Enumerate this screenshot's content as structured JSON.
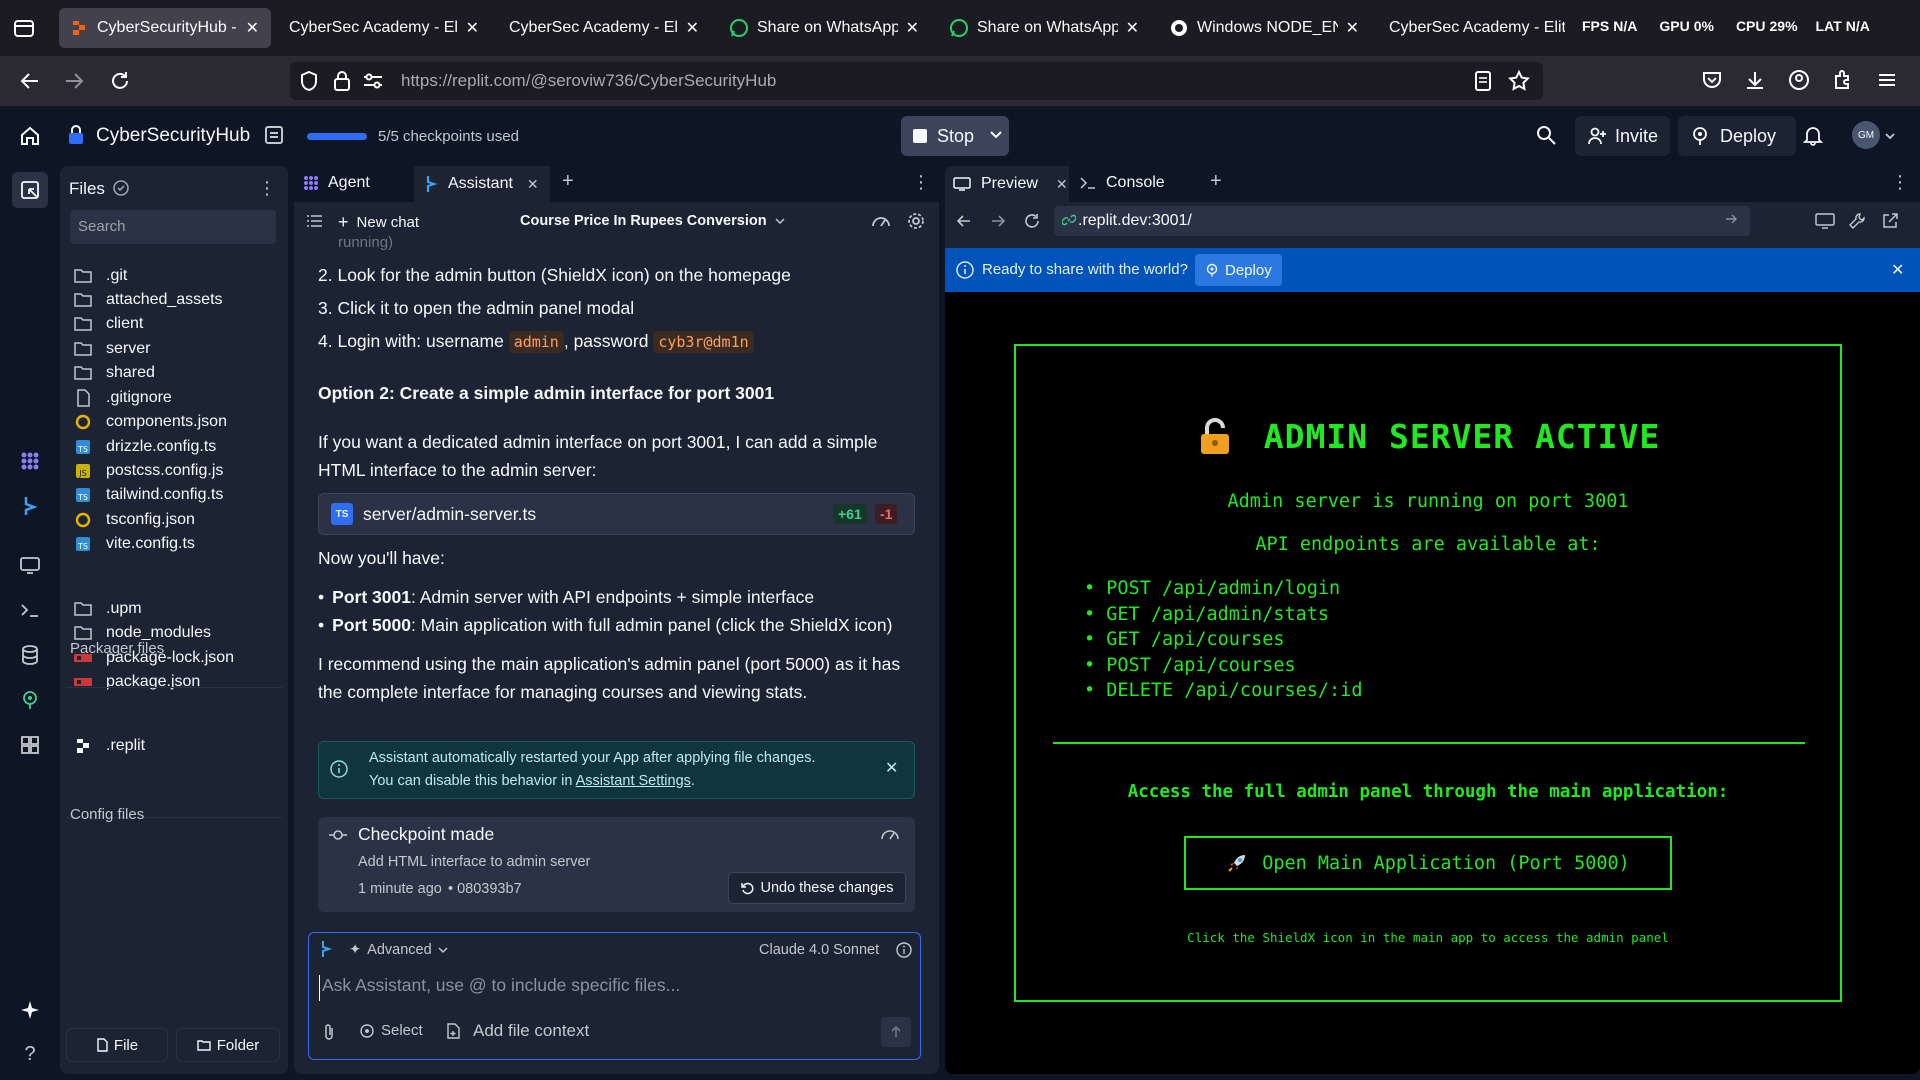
{
  "browser": {
    "tabs": [
      {
        "label": "CyberSecurityHub - Re",
        "active": true
      },
      {
        "label": "CyberSec Academy - Elite (",
        "active": false
      },
      {
        "label": "CyberSec Academy - Elite (",
        "active": false
      },
      {
        "label": "Share on WhatsApp",
        "active": false
      },
      {
        "label": "Share on WhatsApp",
        "active": false
      },
      {
        "label": "Windows NODE_ENV F",
        "active": false
      },
      {
        "label": "CyberSec Academy - Elite (",
        "active": false
      }
    ],
    "stats": {
      "fps_label": "FPS",
      "fps_value": "N/A",
      "gpu_label": "GPU",
      "gpu_value": "0%",
      "cpu_label": "CPU",
      "cpu_value": "29%",
      "lat_label": "LAT",
      "lat_value": "N/A"
    },
    "url_host": "https://replit.com",
    "url_path": "/@seroviw736/CyberSecurityHub"
  },
  "header": {
    "project_name": "CyberSecurityHub",
    "checkpoints": "5/5 checkpoints used",
    "checkpoint_fraction": 1.0,
    "stop_label": "Stop",
    "invite_label": "Invite",
    "deploy_label": "Deploy",
    "avatar_initials": "GM"
  },
  "files": {
    "title": "Files",
    "search_placeholder": "Search",
    "items": [
      ".git",
      "attached_assets",
      "client",
      "server",
      "shared",
      ".gitignore",
      "components.json",
      "drizzle.config.ts",
      "postcss.config.js",
      "tailwind.config.ts",
      "tsconfig.json",
      "vite.config.ts"
    ],
    "packager_title": "Packager files",
    "packager_items": [
      ".upm",
      "node_modules",
      "package-lock.json",
      "package.json"
    ],
    "config_title": "Config files",
    "config_items": [
      ".replit"
    ],
    "file_button": "File",
    "folder_button": "Folder"
  },
  "chat": {
    "tab_agent": "Agent",
    "tab_assistant": "Assistant",
    "new_chat": "New chat",
    "chat_title": "Course Price In Rupees Conversion",
    "clipped_text": "running)",
    "step2": "2. Look for the admin button (ShieldX icon) on the homepage",
    "step3": "3. Click it to open the admin panel modal",
    "step4_prefix": "4. Login with: username",
    "step4_user": "admin",
    "step4_mid": ", password",
    "step4_pass": "cyb3r@dm1n",
    "option2_title": "Option 2: Create a simple admin interface for port 3001",
    "option2_text_1": "If you want a dedicated admin interface on port 3001, I can add a simple",
    "option2_text_2": "HTML interface to the admin server:",
    "file_card": {
      "name": "server/admin-server.ts",
      "added": "+61",
      "removed": "-1"
    },
    "now_have": "Now you'll have:",
    "bullet1_bold": "Port 3001",
    "bullet1_text": ": Admin server with API endpoints + simple interface",
    "bullet2_bold": "Port 5000",
    "bullet2_text": ": Main application with full admin panel (click the ShieldX icon)",
    "recommend_1": "I recommend using the main application's admin panel (port 5000) as it has",
    "recommend_2": "the complete interface for managing courses and viewing stats.",
    "notice_1": "Assistant automatically restarted your App after applying file changes.",
    "notice_2_prefix": "You can disable this behavior in ",
    "notice_link": "Assistant Settings",
    "notice_2_suffix": ".",
    "checkpoint_title": "Checkpoint made",
    "checkpoint_desc": "Add HTML interface to admin server",
    "checkpoint_time": "1 minute ago",
    "checkpoint_hash": "• 080393b7",
    "undo_label": "Undo these changes",
    "advanced_label": "Advanced",
    "model_label": "Claude 4.0 Sonnet",
    "input_placeholder": "Ask Assistant, use @ to include specific files...",
    "select_label": "Select",
    "add_context_label": "Add file context"
  },
  "preview": {
    "tab_preview": "Preview",
    "tab_console": "Console",
    "url": ".replit.dev:3001/",
    "banner_text": "Ready to share with the world?",
    "banner_deploy": "Deploy",
    "page": {
      "title": "ADMIN SERVER ACTIVE",
      "line1": "Admin server is running on port 3001",
      "line2": "API endpoints are available at:",
      "endpoints": [
        "POST /api/admin/login",
        "GET /api/admin/stats",
        "GET /api/courses",
        "POST /api/courses",
        "DELETE /api/courses/:id"
      ],
      "access_text": "Access the full admin panel through the main application:",
      "open_button": "Open Main Application (Port 5000)",
      "hint": "Click the ShieldX icon in the main app to access the admin panel"
    }
  }
}
